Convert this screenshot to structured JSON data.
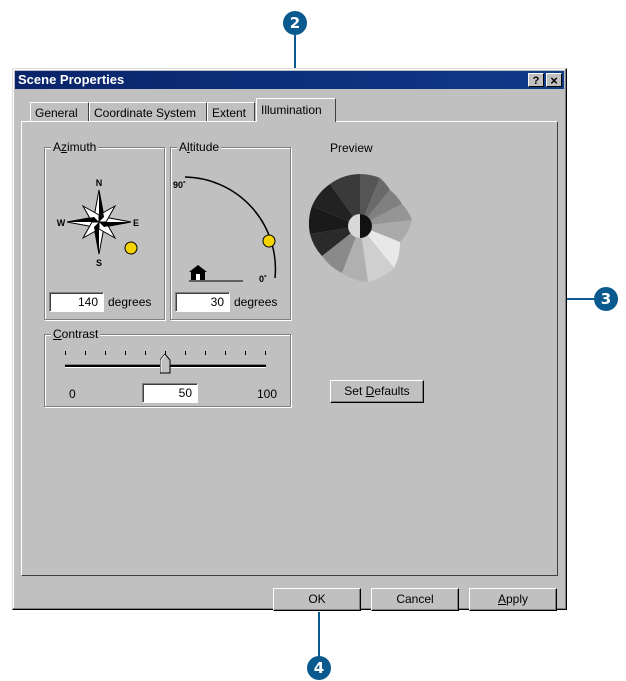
{
  "dialog": {
    "title": "Scene Properties",
    "help_btn": "?",
    "close_btn": "×"
  },
  "tabs": [
    {
      "label": "General"
    },
    {
      "label": "Coordinate System"
    },
    {
      "label": "Extent"
    },
    {
      "label": "Illumination"
    }
  ],
  "azimuth": {
    "label_pre": "A",
    "label_u": "z",
    "label_post": "imuth",
    "compass": {
      "n": "N",
      "s": "S",
      "e": "E",
      "w": "W"
    },
    "value": "140",
    "unit": "degrees"
  },
  "altitude": {
    "label_pre": "A",
    "label_u": "l",
    "label_post": "titude",
    "top_label": "90˚",
    "bottom_label": "0˚",
    "value": "30",
    "unit": "degrees"
  },
  "preview": {
    "label": "Preview"
  },
  "contrast": {
    "label_u": "C",
    "label_post": "ontrast",
    "min": "0",
    "max": "100",
    "value": "50",
    "level_percent": 50
  },
  "buttons": {
    "set_defaults_pre": "Set ",
    "set_defaults_u": "D",
    "set_defaults_post": "efaults",
    "ok": "OK",
    "cancel": "Cancel",
    "apply_u": "A",
    "apply_post": "pply"
  },
  "callouts": {
    "c2": "2",
    "c3": "3",
    "c4": "4"
  },
  "colors": {
    "titlebar": "#0a246a",
    "callout": "#0b5a8f",
    "sun": "#f5d400",
    "dialog": "#c0c0c0"
  }
}
